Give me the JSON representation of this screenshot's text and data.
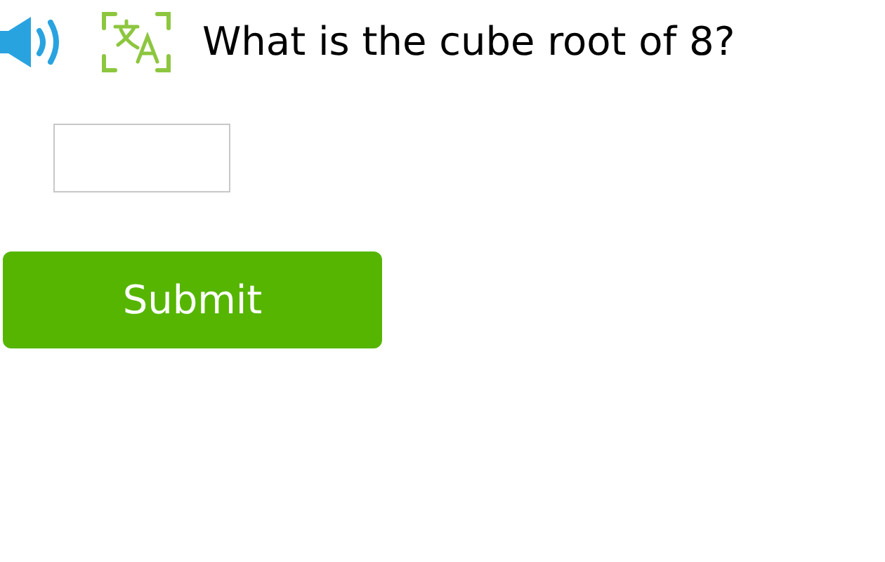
{
  "question": "What is the cube root of 8?",
  "submit": "Submit"
}
